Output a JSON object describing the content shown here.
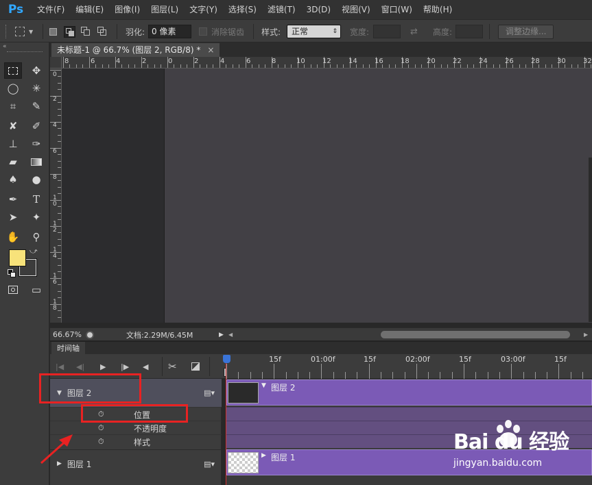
{
  "app": {
    "logo": "Ps",
    "menu": [
      "文件(F)",
      "编辑(E)",
      "图像(I)",
      "图层(L)",
      "文字(Y)",
      "选择(S)",
      "滤镜(T)",
      "3D(D)",
      "视图(V)",
      "窗口(W)",
      "帮助(H)"
    ]
  },
  "options": {
    "feather_label": "羽化:",
    "feather_value": "0 像素",
    "antialias_label": "消除锯齿",
    "style_label": "样式:",
    "style_value": "正常",
    "width_label": "宽度:",
    "height_label": "高度:",
    "refine_button": "调整边缘..."
  },
  "colors": {
    "foreground": "#f7e27a",
    "background": "#3c3c3c",
    "accent": "#31a8ff",
    "clip": "#7b5ab6",
    "highlight": "#e82222"
  },
  "document": {
    "tab_title": "未标题-1 @ 66.7% (图层 2, RGB/8) *",
    "close": "×",
    "ruler_h_labels": [
      "8",
      "6",
      "4",
      "2",
      "0",
      "2",
      "4",
      "6",
      "8",
      "10",
      "12",
      "14",
      "16",
      "18",
      "20",
      "22",
      "24",
      "26",
      "28",
      "30",
      "32"
    ],
    "ruler_v_labels": [
      "0",
      "2",
      "4",
      "6",
      "8",
      "10",
      "12",
      "14",
      "16",
      "18"
    ],
    "zoom": "66.67%",
    "doc_info": "文档:2.29M/6.45M"
  },
  "timeline": {
    "panel_title": "时间轴",
    "ruler_labels": [
      "15f",
      "01:00f",
      "15f",
      "02:00f",
      "15f",
      "03:00f",
      "15f"
    ],
    "layers": [
      {
        "name": "图层 2",
        "properties": [
          "位置",
          "不透明度",
          "样式"
        ]
      },
      {
        "name": "图层 1"
      }
    ],
    "clip_labels": [
      "图层 2",
      "图层 1"
    ]
  },
  "watermark": {
    "logo": "Bai du 经验",
    "url": "jingyan.baidu.com"
  }
}
